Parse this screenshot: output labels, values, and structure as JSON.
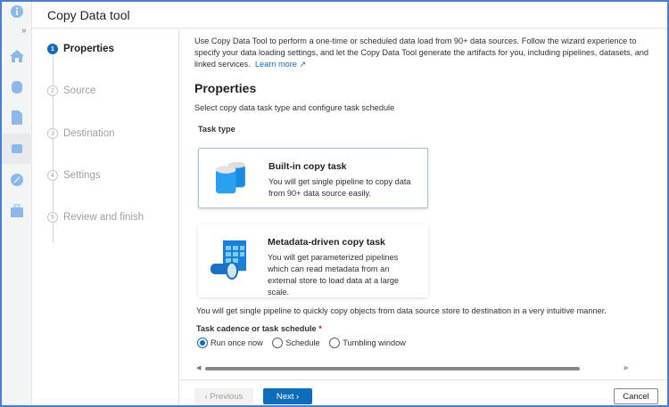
{
  "header": {
    "title": "Copy Data tool"
  },
  "rail": {
    "expand": "»"
  },
  "steps": [
    {
      "num": "1",
      "label": "Properties"
    },
    {
      "num": "2",
      "label": "Source"
    },
    {
      "num": "3",
      "label": "Destination"
    },
    {
      "num": "4",
      "label": "Settings"
    },
    {
      "num": "5",
      "label": "Review and finish"
    }
  ],
  "main": {
    "intro": "Use Copy Data Tool to perform a one-time or scheduled data load from 90+ data sources. Follow the wizard experience to specify your data loading settings, and let the Copy Data Tool generate the artifacts for you, including pipelines, datasets, and linked services.",
    "learn_more": "Learn more",
    "title": "Properties",
    "subtitle": "Select copy data task type and configure task schedule",
    "task_type_label": "Task type",
    "cards": [
      {
        "title": "Built-in copy task",
        "desc": "You will get single pipeline to copy data from 90+ data source easily."
      },
      {
        "title": "Metadata-driven copy task",
        "desc": "You will get parameterized pipelines which can read metadata from an external store to load data at a large scale."
      }
    ],
    "note": "You will get single pipeline to quickly copy objects from data source store to destination in a very intuitive manner.",
    "cadence_label": "Task cadence or task schedule",
    "required": "*",
    "options": [
      "Run once now",
      "Schedule",
      "Tumbling window"
    ],
    "selected": "Run once now"
  },
  "footer": {
    "previous": "‹  Previous",
    "next": "Next  ›",
    "cancel": "Cancel"
  }
}
